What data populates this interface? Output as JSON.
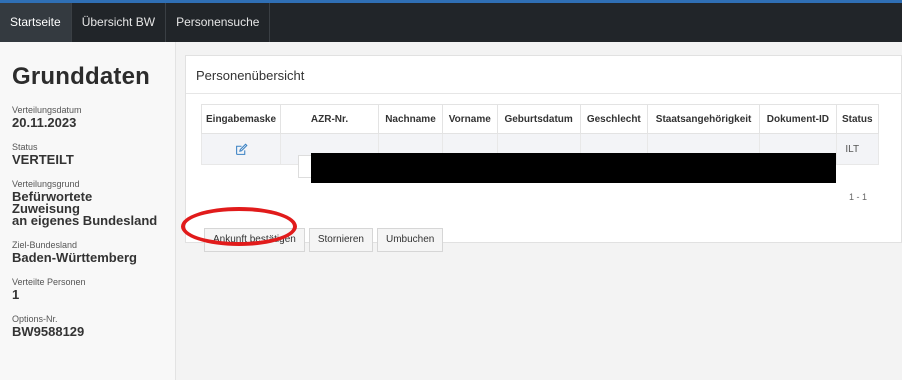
{
  "nav": {
    "tabs": [
      {
        "label": "Startseite",
        "active": true
      },
      {
        "label": "Übersicht BW",
        "active": false
      },
      {
        "label": "Personensuche",
        "active": false
      }
    ]
  },
  "sidebar": {
    "title": "Grunddaten",
    "fields": [
      {
        "label": "Verteilungsdatum",
        "value": "20.11.2023"
      },
      {
        "label": "Status",
        "value": "VERTEILT"
      },
      {
        "label": "Verteilungsgrund",
        "value_line1": "Befürwortete Zuweisung",
        "value_line2": "an eigenes Bundesland"
      },
      {
        "label": "Ziel-Bundesland",
        "value": "Baden-Württemberg"
      },
      {
        "label": "Verteilte Personen",
        "value": "1"
      },
      {
        "label": "Options-Nr.",
        "value": "BW9588129"
      }
    ]
  },
  "panel": {
    "title": "Personenübersicht",
    "columns": [
      "Eingabemaske",
      "AZR-Nr.",
      "Nachname",
      "Vorname",
      "Geburtsdatum",
      "Geschlecht",
      "Staatsangehörigkeit",
      "Dokument-ID",
      "Status"
    ],
    "row": {
      "status_partial": "ILT"
    },
    "pager": "1 - 1"
  },
  "buttons": {
    "confirm": "Ankunft bestätigen",
    "cancel": "Stornieren",
    "rebook": "Umbuchen"
  },
  "colors": {
    "nav_bg": "#212529",
    "nav_accent": "#2f6fb5",
    "highlight_circle": "#e11b1b",
    "edit_icon": "#3b82c4"
  }
}
